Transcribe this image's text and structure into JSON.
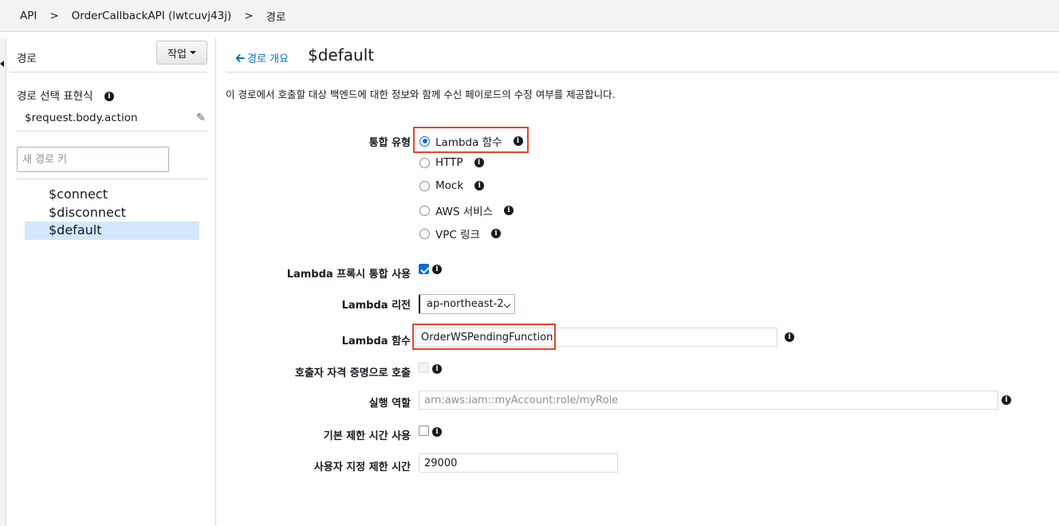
{
  "breadcrumb": {
    "items": [
      "API",
      "OrderCallbackAPI (lwtcuvj43j)",
      "경로"
    ],
    "separator": ">"
  },
  "sidebar": {
    "title": "경로",
    "action_button": "작업",
    "route_selection_label": "경로 선택 표현식",
    "route_selection_value": "$request.body.action",
    "new_route_placeholder": "새 경로 키",
    "routes": [
      "$connect",
      "$disconnect",
      "$default"
    ],
    "selected_route": "$default"
  },
  "main": {
    "back_link": "경로 개요",
    "title": "$default",
    "description": "이 경로에서 호출할 대상 백엔드에 대한 정보와 함께 수신 페이로드의 수정 여부를 제공합니다.",
    "integration_type_label": "통합 유형",
    "integration_types": [
      "Lambda 함수",
      "HTTP",
      "Mock",
      "AWS 서비스",
      "VPC 링크"
    ],
    "integration_type_selected": "Lambda 함수",
    "proxy_label": "Lambda 프록시 통합 사용",
    "proxy_checked": true,
    "region_label": "Lambda 리전",
    "region_value": "ap-northeast-2",
    "function_label": "Lambda 함수",
    "function_value": "OrderWSPendingFunction",
    "caller_credentials_label": "호출자 자격 증명으로 호출",
    "execution_role_label": "실행 역할",
    "execution_role_placeholder": "arn:aws:iam::myAccount:role/myRole",
    "default_timeout_label": "기본 제한 시간 사용",
    "custom_timeout_label": "사용자 지정 제한 시간",
    "custom_timeout_value": "29000"
  },
  "colors": {
    "accent": "#0a6ad9",
    "link": "#0073bb",
    "highlight_box": "#e0472e",
    "selected_route_bg": "#d4e6f9"
  }
}
